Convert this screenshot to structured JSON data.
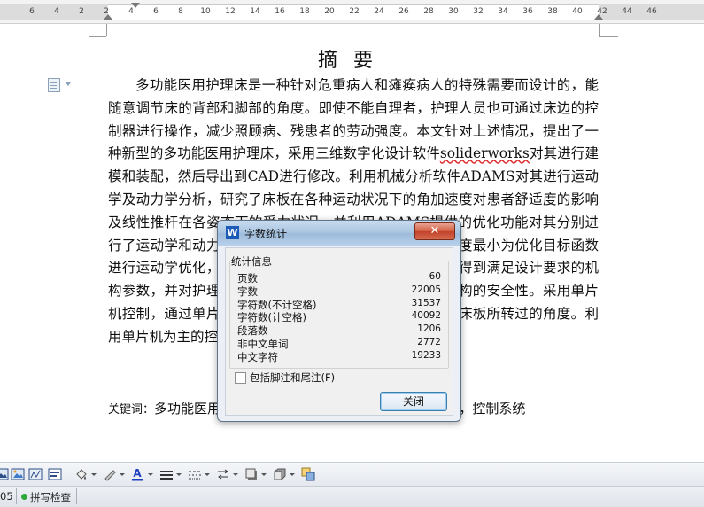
{
  "ruler": {
    "ticks": [
      "6",
      "4",
      "2",
      "2",
      "4",
      "6",
      "8",
      "10",
      "12",
      "14",
      "16",
      "18",
      "20",
      "22",
      "24",
      "26",
      "28",
      "30",
      "32",
      "34",
      "36",
      "38",
      "40",
      "42",
      "44",
      "46"
    ]
  },
  "document": {
    "title": "摘要",
    "paragraph_before": "多功能医用护理床是一种针对危重病人和瘫痪病人的特殊需要而设计的，能随意调节床的背部和脚部的角度。即使不能自理者，护理人员也可通过床边的控制器进行操作，减少照顾病、残患者的劳动强度。本文针对上述情况，提出了一种新型的多功能医用护理床，采用三维数字化设计软件",
    "spell_word": "soliderworks",
    "paragraph_after": "对其进行建模和装配，然后导出到CAD进行修改。利用机械分析软件ADAMS对其进行运动学及动力学分析，研究了床板在各种运动状况下的角加速度对患者舒适度的影响及线性推杆在各姿态下的受力状况，并利用ADAMS提供的优化功能对其分别进行了运动学和动力学优化，以线性推杆受力最小和角加速度最小为优化目标函数进行运动学优化，以线性推杆受力最小为优化目标函数，得到满足设计要求的机构参数，并对护理床的主要零件进行力学计算，保证了机构的安全性。采用单片机控制，通过单片机控制，实现各个部位的运动，并监测床板所转过的角度。利用单片机为主的控制系统。",
    "keywords_label": "关键词：",
    "keywords_text": "多功能医用护理床；ADAMS；运动学及动力学优化，控制系统"
  },
  "dialog": {
    "app_icon": "W",
    "title": "字数统计",
    "close_glyph": "✕",
    "group_label": "统计信息",
    "stats": [
      {
        "label": "页数",
        "value": "60"
      },
      {
        "label": "字数",
        "value": "22005"
      },
      {
        "label": "字符数(不计空格)",
        "value": "31537"
      },
      {
        "label": "字符数(计空格)",
        "value": "40092"
      },
      {
        "label": "段落数",
        "value": "1206"
      },
      {
        "label": "非中文单词",
        "value": "2772"
      },
      {
        "label": "中文字符",
        "value": "19233"
      }
    ],
    "checkbox_label": "包括脚注和尾注(F)",
    "ok_label": "关闭"
  },
  "statusbar": {
    "page_num": "05",
    "spell_check": "拼写检查"
  },
  "colors": {
    "font_color_a": "#1f3fbf",
    "title_bar": "#a9c4e0",
    "close_red": "#c2412a"
  }
}
